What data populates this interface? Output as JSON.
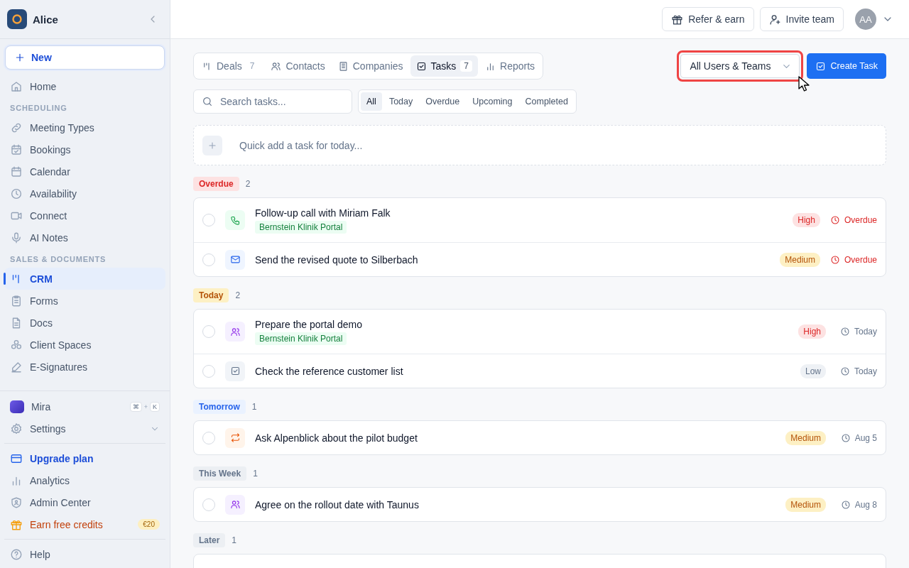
{
  "sidebar": {
    "workspace": "Alice",
    "new_button": "New",
    "nav": [
      {
        "kind": "item",
        "label": "Home",
        "selected": false
      },
      {
        "kind": "section",
        "label": "SCHEDULING"
      },
      {
        "kind": "item",
        "label": "Meeting Types",
        "selected": false
      },
      {
        "kind": "item",
        "label": "Bookings",
        "selected": false
      },
      {
        "kind": "item",
        "label": "Calendar",
        "selected": false
      },
      {
        "kind": "item",
        "label": "Availability",
        "selected": false
      },
      {
        "kind": "item",
        "label": "Connect",
        "selected": false
      },
      {
        "kind": "item",
        "label": "AI Notes",
        "selected": false
      },
      {
        "kind": "section",
        "label": "SALES & DOCUMENTS"
      },
      {
        "kind": "item",
        "label": "CRM",
        "selected": true
      },
      {
        "kind": "item",
        "label": "Forms",
        "selected": false
      },
      {
        "kind": "item",
        "label": "Docs",
        "selected": false
      },
      {
        "kind": "item",
        "label": "Client Spaces",
        "selected": false
      },
      {
        "kind": "item",
        "label": "E-Signatures",
        "selected": false
      }
    ],
    "assistant": {
      "label": "Mira",
      "keys": [
        "⌘",
        "+",
        "K"
      ]
    },
    "settings": {
      "label": "Settings",
      "expanded": false
    },
    "bottom": [
      {
        "kind": "upgrade",
        "label": "Upgrade plan"
      },
      {
        "kind": "plain",
        "label": "Analytics"
      },
      {
        "kind": "plain",
        "label": "Admin Center"
      },
      {
        "kind": "reward",
        "label": "Earn free credits",
        "badge": "€20"
      }
    ],
    "help": "Help"
  },
  "topbar": {
    "buttons": [
      "Refer & earn",
      "Invite team"
    ],
    "avatar": "AA"
  },
  "tabs": [
    {
      "label": "Deals",
      "count": "7",
      "selected": false
    },
    {
      "label": "Contacts",
      "selected": false
    },
    {
      "label": "Companies",
      "selected": false
    },
    {
      "label": "Tasks",
      "count": "7",
      "selected": true
    },
    {
      "label": "Reports",
      "selected": false
    }
  ],
  "owner_filter": {
    "value": "All Users & Teams",
    "highlighted": true
  },
  "create_button": "Create Task",
  "search": {
    "placeholder": "Search tasks..."
  },
  "filters": [
    {
      "label": "All",
      "selected": true
    },
    {
      "label": "Today",
      "selected": false
    },
    {
      "label": "Overdue",
      "selected": false
    },
    {
      "label": "Upcoming",
      "selected": false
    },
    {
      "label": "Completed",
      "selected": false
    }
  ],
  "quick_add": {
    "placeholder": "Quick add a task for today..."
  },
  "groups": [
    {
      "label": "Overdue",
      "kind": "overdue",
      "count": "2",
      "tasks": [
        {
          "title": "Follow-up call with Miriam Falk",
          "kind": "call",
          "tag": "Bernstein Klinik Portal",
          "checked": false,
          "priority": {
            "label": "High",
            "kind": "high"
          },
          "due": {
            "label": "Overdue",
            "overdue": true
          }
        },
        {
          "title": "Send the revised quote to Silberbach",
          "kind": "email",
          "checked": false,
          "priority": {
            "label": "Medium",
            "kind": "medium"
          },
          "due": {
            "label": "Overdue",
            "overdue": true
          }
        }
      ]
    },
    {
      "label": "Today",
      "kind": "today",
      "count": "2",
      "tasks": [
        {
          "title": "Prepare the portal demo",
          "kind": "meeting",
          "tag": "Bernstein Klinik Portal",
          "checked": false,
          "priority": {
            "label": "High",
            "kind": "high"
          },
          "due": {
            "label": "Today",
            "overdue": false
          }
        },
        {
          "title": "Check the reference customer list",
          "kind": "todo",
          "checked": false,
          "priority": {
            "label": "Low",
            "kind": "low"
          },
          "due": {
            "label": "Today",
            "overdue": false
          }
        }
      ]
    },
    {
      "label": "Tomorrow",
      "kind": "tomorrow",
      "count": "1",
      "tasks": [
        {
          "title": "Ask Alpenblick about the pilot budget",
          "kind": "followup",
          "checked": false,
          "priority": {
            "label": "Medium",
            "kind": "medium"
          },
          "due": {
            "label": "Aug 5",
            "overdue": false
          }
        }
      ]
    },
    {
      "label": "This Week",
      "kind": "neutral",
      "count": "1",
      "tasks": [
        {
          "title": "Agree on the rollout date with Taunus",
          "kind": "meeting",
          "checked": false,
          "priority": {
            "label": "Medium",
            "kind": "medium"
          },
          "due": {
            "label": "Aug 8",
            "overdue": false
          }
        }
      ]
    },
    {
      "label": "Later",
      "kind": "neutral",
      "count": "1"
    }
  ]
}
